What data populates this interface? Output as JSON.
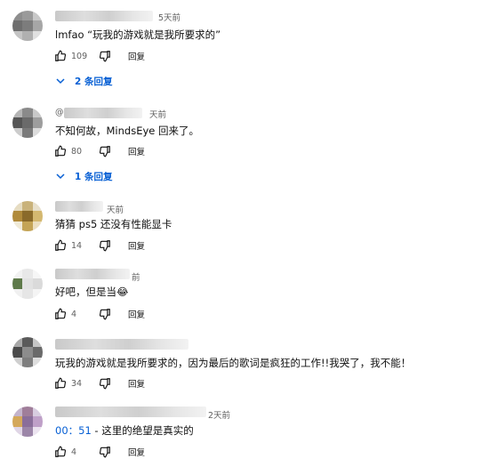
{
  "comments": [
    {
      "time": "5天前",
      "text": "lmfao “玩我的游戏就是我所要求的”",
      "likes": "109",
      "reply_label": "回复",
      "replies_label": "2 条回复",
      "avatar_colors": [
        "#8e8e8e",
        "#9a9a9a",
        "#c8c8c8",
        "#6e6e6e",
        "#7c7c7c",
        "#a6a6a6",
        "#c4c4c4",
        "#b0b0b0",
        "#e0e0e0"
      ]
    },
    {
      "time": "天前",
      "prefix": "@",
      "text": "不知何故，MindsEye 回来了。",
      "likes": "80",
      "reply_label": "回复",
      "replies_label": "1 条回复",
      "avatar_colors": [
        "#b5b5b5",
        "#8a8a8a",
        "#c9c9c9",
        "#555555",
        "#6a6a6a",
        "#9d9d9d",
        "#cccccc",
        "#7a7a7a",
        "#dcdcdc"
      ]
    },
    {
      "time": "天前",
      "text": "猜猜 ps5 还没有性能显卡",
      "likes": "14",
      "reply_label": "回复",
      "avatar_colors": [
        "#e6dcc2",
        "#c9b27a",
        "#e8e0cc",
        "#b08a3a",
        "#8a6a2a",
        "#d4b870",
        "#f0ead8",
        "#c4a456",
        "#ecdfc0"
      ]
    },
    {
      "time": "前",
      "text": "好吧，但是当😂",
      "likes": "4",
      "reply_label": "回复",
      "avatar_colors": [
        "#f2f2f2",
        "#e8e8e8",
        "#f6f6f6",
        "#5e7a4a",
        "#e2e2e2",
        "#dadada",
        "#f0f0f0",
        "#e6e6e6",
        "#f4f4f4"
      ]
    },
    {
      "time": "",
      "text": "玩我的游戏就是我所要求的，因为最后的歌词是疯狂的工作!!我哭了，我不能！",
      "likes": "34",
      "reply_label": "回复",
      "avatar_colors": [
        "#a8a8a8",
        "#5a5a5a",
        "#c6c6c6",
        "#4a4a4a",
        "#8c8c8c",
        "#6a6a6a",
        "#cfcfcf",
        "#7e7e7e",
        "#dedede"
      ]
    },
    {
      "time": "2天前",
      "timestamp": "00：51",
      "text": " - 这里的绝望是真实的",
      "likes": "4",
      "reply_label": "回复",
      "avatar_colors": [
        "#c4b4cc",
        "#a07e9a",
        "#d8cde0",
        "#d4a85a",
        "#8a6e9a",
        "#bfa0c8",
        "#e0d6e6",
        "#9c86a8",
        "#ece4f0"
      ]
    }
  ]
}
